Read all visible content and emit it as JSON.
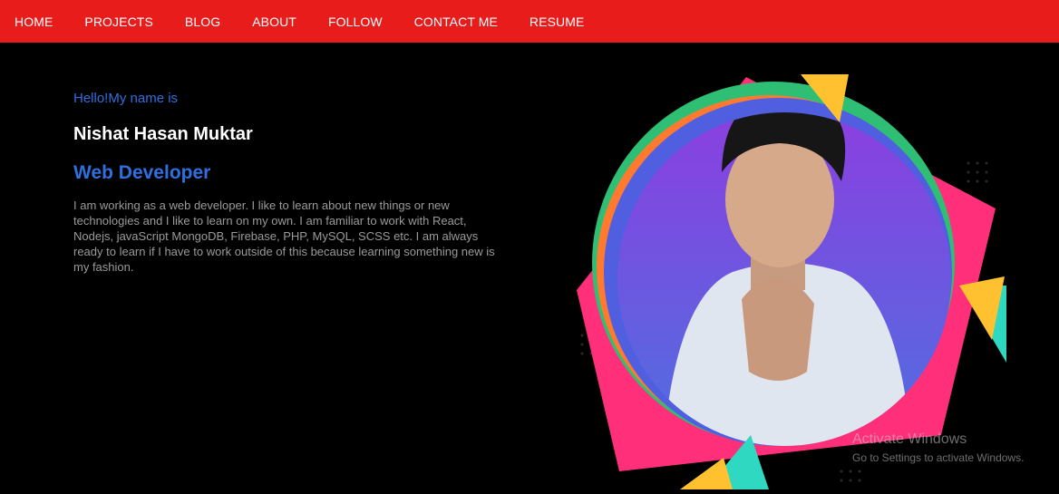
{
  "nav": {
    "items": [
      "HOME",
      "PROJECTS",
      "BLOG",
      "ABOUT",
      "FOLLOW",
      "CONTACT ME",
      "RESUME"
    ]
  },
  "intro": {
    "greeting": "Hello!My name is",
    "name": "Nishat Hasan Muktar",
    "role": "Web Developer",
    "bio": "I am working as a web developer. I like to learn about new things or new technologies and I like to learn on my own. I am familiar to work with React, Nodejs, javaScript MongoDB, Firebase, PHP, MySQL, SCSS etc. I am always ready to learn if I have to work outside of this because learning something new is my fashion."
  },
  "watermark": {
    "title": "Activate Windows",
    "subtitle": "Go to Settings to activate Windows."
  },
  "colors": {
    "nav_bg": "#e91c1c",
    "accent": "#2f6fe0",
    "page_bg": "#000000"
  }
}
